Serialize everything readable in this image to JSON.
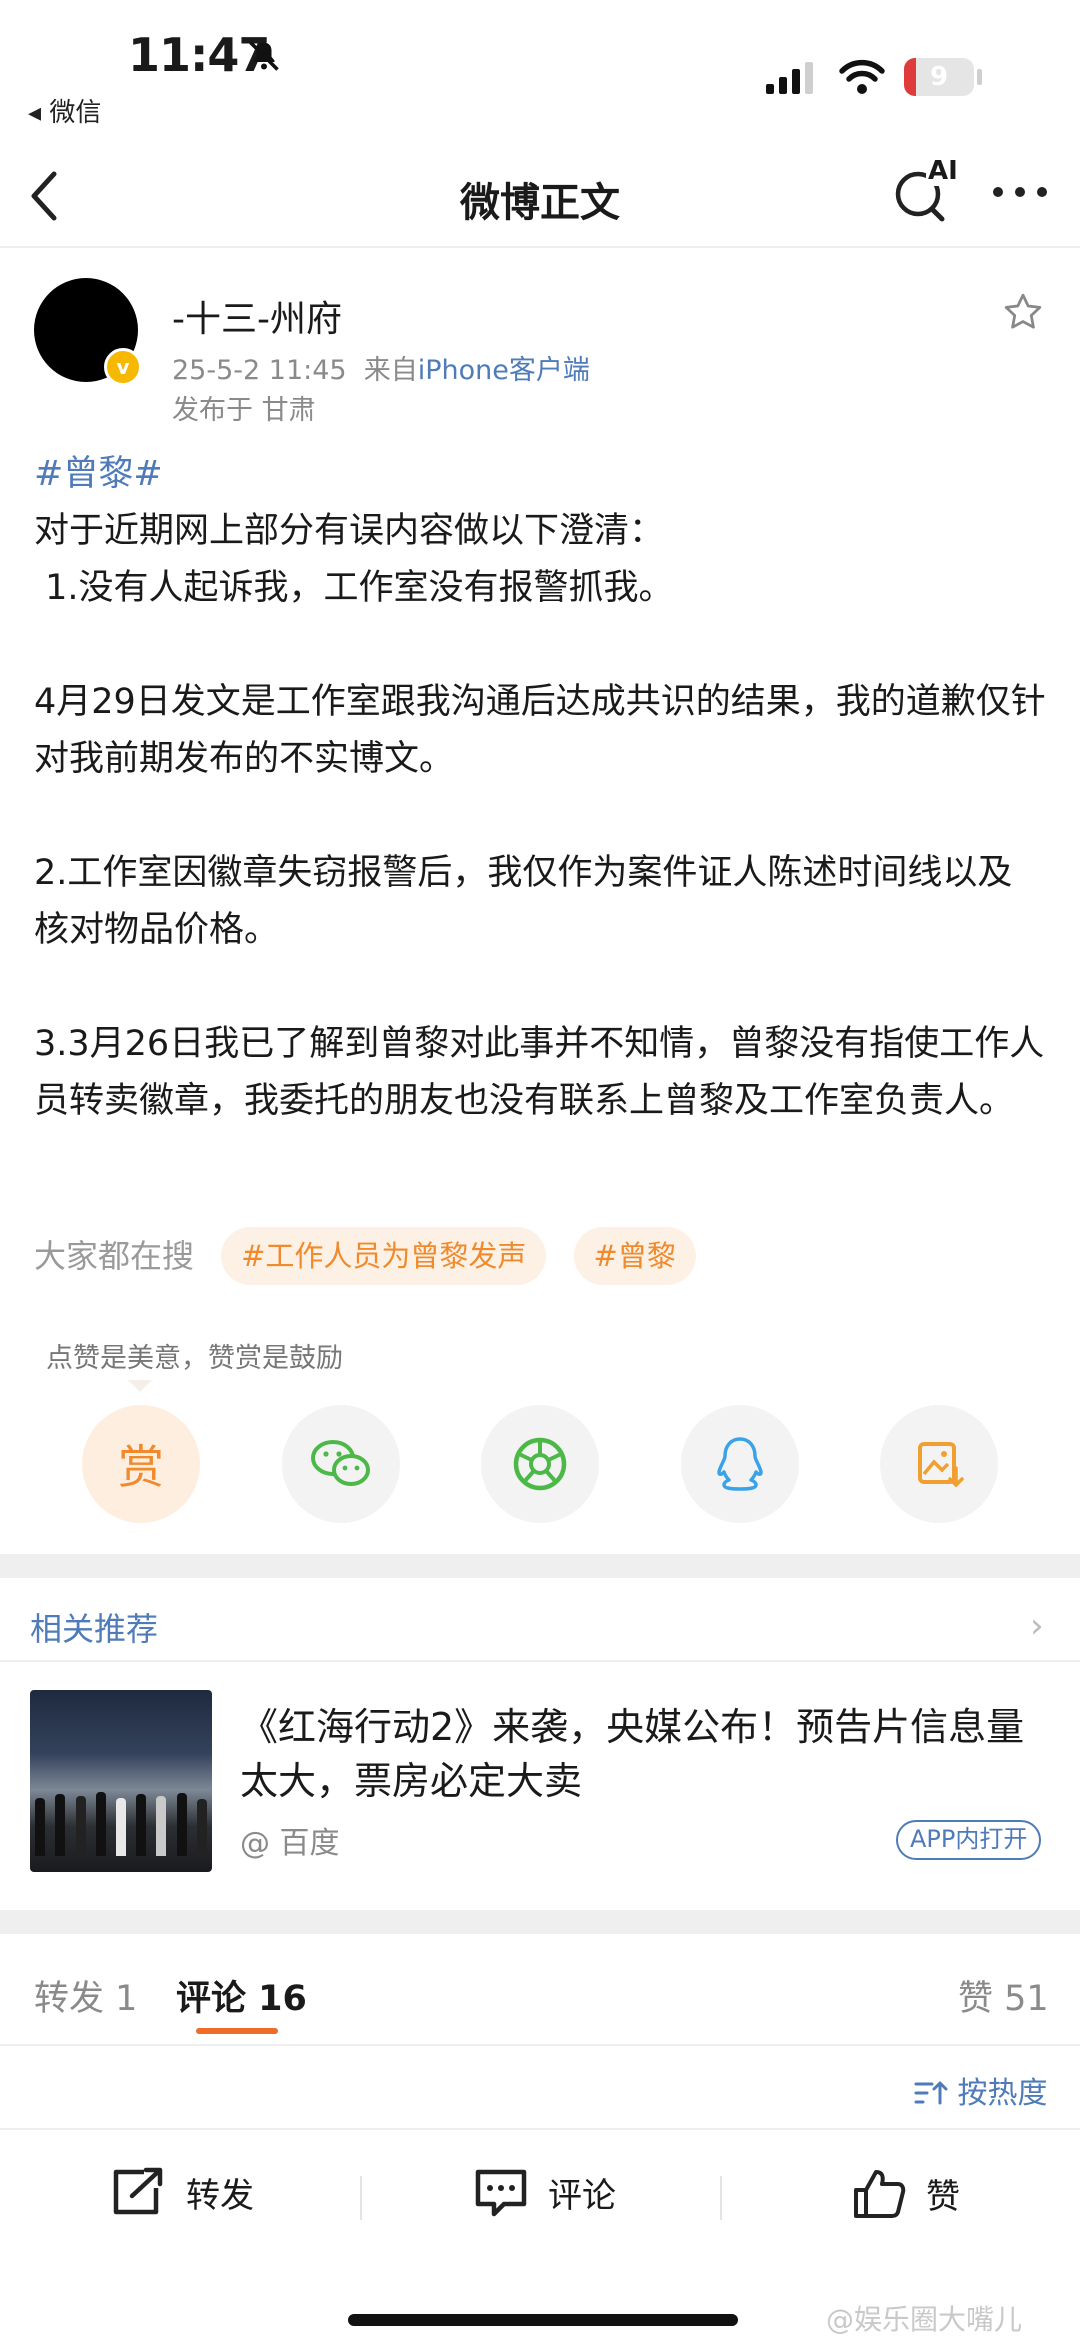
{
  "status_bar": {
    "time": "11:47",
    "back_app": "◂ 微信",
    "battery": "9"
  },
  "nav": {
    "title": "微博正文",
    "ai_label": "AI",
    "icons": [
      "back-chevron-icon",
      "ai-search-icon",
      "more-icon"
    ]
  },
  "post": {
    "username": "-十三-州府",
    "time": "25-5-2 11:45",
    "source_prefix": "来自",
    "source": "iPhone客户端",
    "location": "发布于 甘肃",
    "verified_badge": "v",
    "hashtag": "#曾黎#",
    "paragraphs": [
      "对于近期网上部分有误内容做以下澄清：",
      " 1.没有人起诉我，工作室没有报警抓我。",
      "",
      "4月29日发文是工作室跟我沟通后达成共识的结果，我的道歉仅针对我前期发布的不实博文。",
      "",
      "2.工作室因徽章失窃报警后，我仅作为案件证人陈述时间线以及核对物品价格。",
      "",
      "3.3月26日我已了解到曾黎对此事并不知情，曾黎没有指使工作人员转卖徽章，我委托的朋友也没有联系上曾黎及工作室负责人。"
    ]
  },
  "search": {
    "label": "大家都在搜",
    "chips": [
      "#工作人员为曾黎发声",
      "#曾黎"
    ]
  },
  "share": {
    "tip": "点赞是美意，赞赏是鼓励",
    "reward_label": "赏",
    "icons": [
      "wechat-icon",
      "moments-icon",
      "qq-icon",
      "save-image-icon"
    ]
  },
  "related": {
    "title": "相关推荐",
    "headline": "《红海行动2》来袭，央媒公布！预告片信息量太大，票房必定大卖",
    "source": "@ 百度",
    "open_button": "APP内打开"
  },
  "tabs": {
    "repost": "转发 1",
    "comments": "评论 16",
    "likes": "赞 51",
    "sort": "按热度"
  },
  "actions": {
    "repost": "转发",
    "comment": "评论",
    "like": "赞"
  },
  "watermark": "@娱乐圈大嘴儿",
  "colors": {
    "link_blue": "#4f7bb8",
    "accent_orange": "#f06b27",
    "chip_orange": "#f08a2c"
  }
}
